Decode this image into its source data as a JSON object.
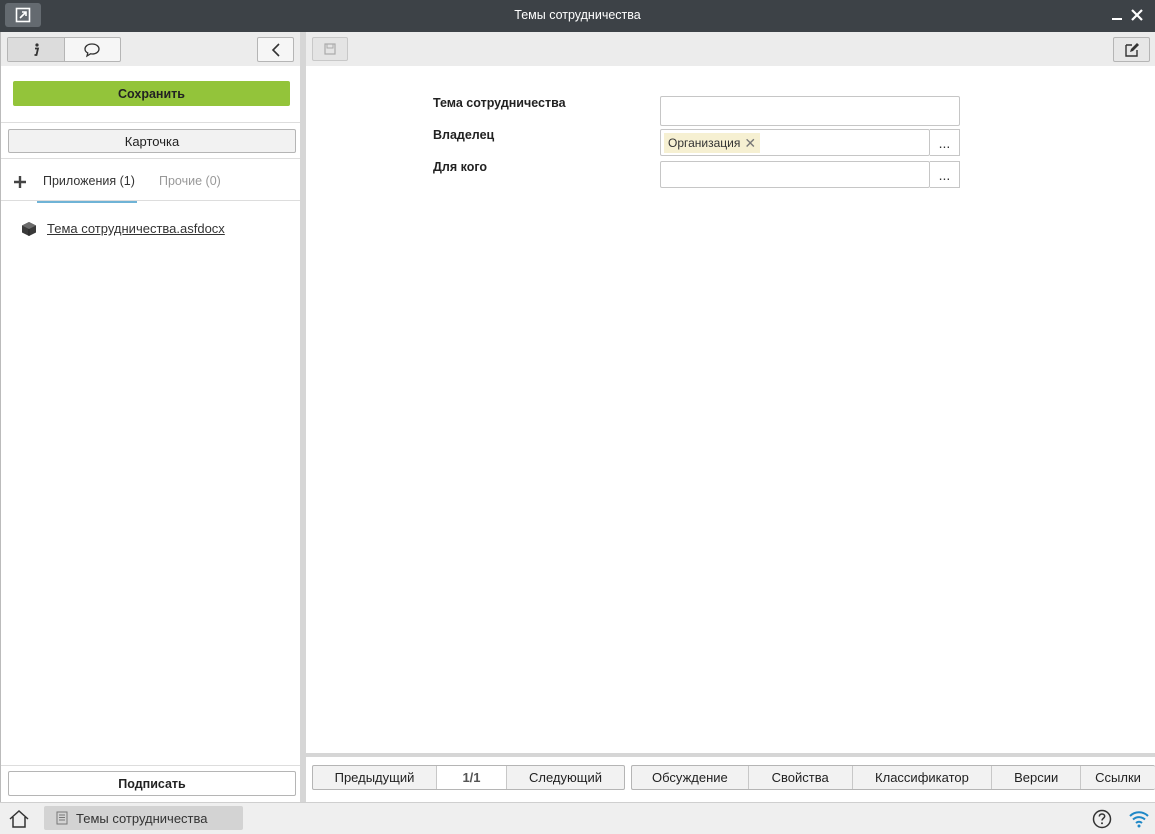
{
  "window": {
    "title": "Темы сотрудничества"
  },
  "sidebar": {
    "save_label": "Сохранить",
    "card_label": "Карточка",
    "tabs": [
      {
        "label": "Приложения (1)",
        "active": true
      },
      {
        "label": "Прочие (0)",
        "active": false
      }
    ],
    "attachments": [
      {
        "name": "Тема сотрудничества.asfdocx"
      }
    ],
    "sign_label": "Подписать"
  },
  "form": {
    "fields": [
      {
        "label": "Тема сотрудничества",
        "value": ""
      },
      {
        "label": "Владелец",
        "tag": "Организация",
        "dots": "..."
      },
      {
        "label": "Для кого",
        "value": "",
        "dots": "..."
      }
    ]
  },
  "bottom_nav": {
    "prev": "Предыдущий",
    "page": "1/1",
    "next": "Следующий",
    "tabs": [
      "Обсуждение",
      "Свойства",
      "Классификатор",
      "Версии",
      "Ссылки"
    ]
  },
  "taskbar": {
    "task_label": "Темы сотрудничества"
  },
  "colors": {
    "titlebar": "#3d4247",
    "save_button": "#93c43a",
    "active_tab_underline": "#6fb3d6",
    "tag_bg": "#f6f0d2"
  },
  "icons": [
    "external-window-icon",
    "minimize-icon",
    "close-icon",
    "info-icon",
    "comment-icon",
    "chevron-left-icon",
    "plus-icon",
    "document-cube-icon",
    "save-disk-icon",
    "edit-icon",
    "home-icon",
    "document-icon",
    "help-icon",
    "wifi-icon"
  ]
}
